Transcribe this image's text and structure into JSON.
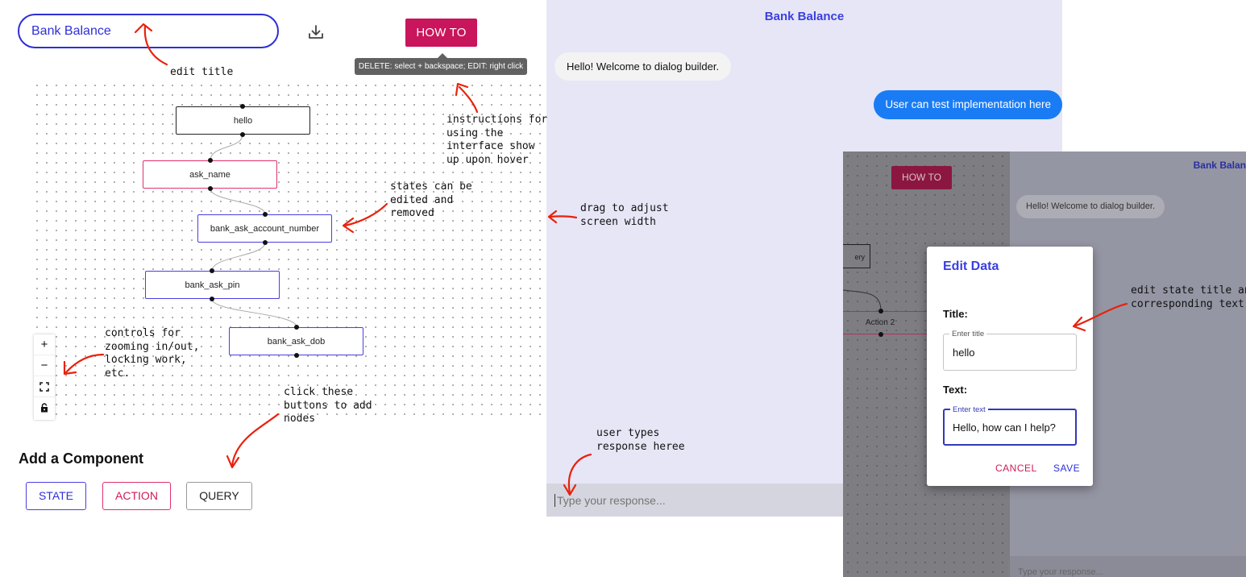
{
  "builder": {
    "title": "Bank Balance",
    "howto_label": "HOW TO",
    "tooltip": "DELETE: select + backspace; EDIT: right click",
    "nodes": [
      {
        "label": "hello",
        "kind": "plain"
      },
      {
        "label": "ask_name",
        "kind": "action"
      },
      {
        "label": "bank_ask_account_number",
        "kind": "state"
      },
      {
        "label": "bank_ask_pin",
        "kind": "state"
      },
      {
        "label": "bank_ask_dob",
        "kind": "state"
      }
    ],
    "controls": [
      "+",
      "−",
      "fit-view-icon",
      "lock-icon"
    ],
    "add_component_title": "Add a Component",
    "add_buttons": {
      "state": "STATE",
      "action": "ACTION",
      "query": "QUERY"
    },
    "colors": {
      "accent": "#2d2fd6",
      "action": "#e0306e",
      "howto": "#c8155b"
    }
  },
  "annotations": {
    "edit_title": "edit title",
    "instructions": "instructions for\nusing the\ninterface show\nup upon hover",
    "states_edit": "states can be\nedited and\nremoved",
    "drag_width": "drag to adjust\nscreen width",
    "controls": "controls for\nzooming in/out,\nlocking work,\netc.",
    "add_nodes": "click these\nbuttons to add\nnodes",
    "user_types": "user types\nresponse heree",
    "edit_state": "edit state title and\ncorresponding text"
  },
  "chat": {
    "title": "Bank Balance",
    "bot_message": "Hello! Welcome to dialog builder.",
    "user_message": "User can test implementation here",
    "input_placeholder": "Type your response..."
  },
  "overlay": {
    "howto_label": "HOW TO",
    "query_node": "ery",
    "action_node": "Action 2",
    "title": "Bank Balan",
    "bot_message": "Hello! Welcome to dialog builder.",
    "input_placeholder": "Type your response..."
  },
  "dialog": {
    "title": "Edit Data",
    "title_label": "Title:",
    "title_legend": "Enter title",
    "title_value": "hello",
    "text_label": "Text:",
    "text_legend": "Enter text",
    "text_value": "Hello, how can I help?",
    "cancel": "CANCEL",
    "save": "SAVE"
  }
}
